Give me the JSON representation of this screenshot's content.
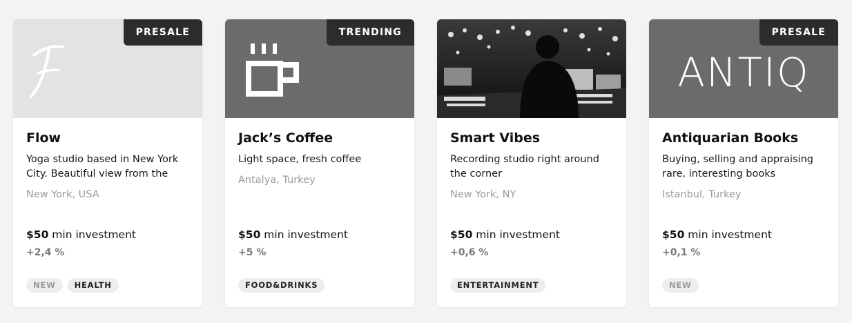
{
  "cards": [
    {
      "badge": "PRESALE",
      "title": "Flow",
      "description": "Yoga studio based in New York City. Beautiful view from the",
      "location": "New York, USA",
      "invest_amount": "$50",
      "invest_label": " min investment",
      "change": "+2,4 %",
      "tags": [
        {
          "label": "NEW",
          "muted": true
        },
        {
          "label": "HEALTH",
          "muted": false
        }
      ],
      "cover_icon": "flow-logo"
    },
    {
      "badge": "TRENDING",
      "title": "Jack’s Coffee",
      "description": "Light space, fresh coffee",
      "location": "Antalya, Turkey",
      "invest_amount": "$50",
      "invest_label": " min investment",
      "change": "+5 %",
      "tags": [
        {
          "label": "FOOD&DRINKS",
          "muted": false
        }
      ],
      "cover_icon": "coffee-cup-logo"
    },
    {
      "badge": "",
      "title": "Smart Vibes",
      "description": "Recording studio right around the corner",
      "location": "New York, NY",
      "invest_amount": "$50",
      "invest_label": " min investment",
      "change": "+0,6 %",
      "tags": [
        {
          "label": "ENTERTAINMENT",
          "muted": false
        }
      ],
      "cover_icon": "recording-studio-photo"
    },
    {
      "badge": "PRESALE",
      "title": "Antiquarian Books",
      "description": "Buying, selling and appraising rare, interesting books",
      "location": "Istanbul, Turkey",
      "invest_amount": "$50",
      "invest_label": " min investment",
      "change": "+0,1 %",
      "tags": [
        {
          "label": "NEW",
          "muted": true
        }
      ],
      "cover_icon": "antiq-logo",
      "cover_text": "ANTIQ"
    }
  ]
}
